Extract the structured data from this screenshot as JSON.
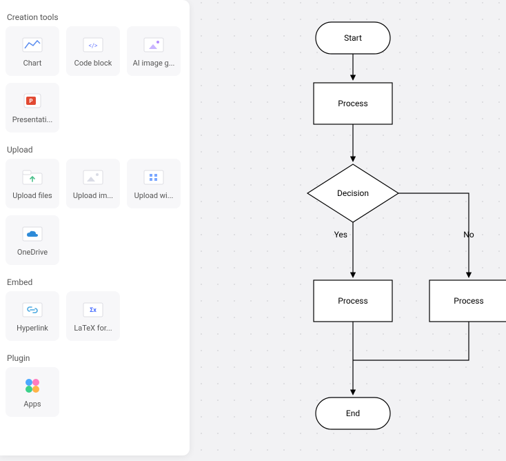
{
  "panel": {
    "sections": {
      "creation": {
        "title": "Creation tools",
        "items": [
          {
            "label": "Chart"
          },
          {
            "label": "Code block"
          },
          {
            "label": "AI image g..."
          },
          {
            "label": "Presentati..."
          }
        ]
      },
      "upload": {
        "title": "Upload",
        "items": [
          {
            "label": "Upload files"
          },
          {
            "label": "Upload im..."
          },
          {
            "label": "Upload wi..."
          },
          {
            "label": "OneDrive"
          }
        ]
      },
      "embed": {
        "title": "Embed",
        "items": [
          {
            "label": "Hyperlink"
          },
          {
            "label": "LaTeX for..."
          }
        ]
      },
      "plugin": {
        "title": "Plugin",
        "items": [
          {
            "label": "Apps"
          }
        ]
      }
    }
  },
  "flowchart": {
    "nodes": {
      "start": "Start",
      "process1": "Process",
      "decision": "Decision",
      "yes": "Yes",
      "no": "No",
      "process2": "Process",
      "process3": "Process",
      "end": "End"
    }
  }
}
